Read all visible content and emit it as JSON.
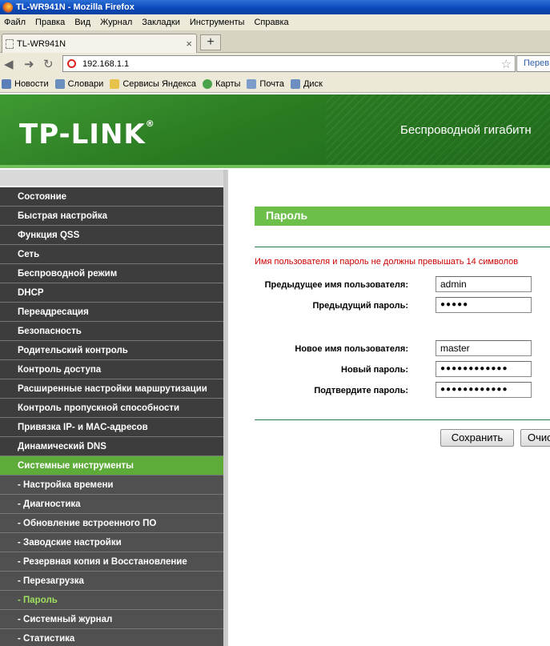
{
  "window": {
    "title": "TL-WR941N - Mozilla Firefox"
  },
  "menubar": [
    "Файл",
    "Правка",
    "Вид",
    "Журнал",
    "Закладки",
    "Инструменты",
    "Справка"
  ],
  "tab": {
    "label": "TL-WR941N",
    "close": "×",
    "new_tab": "+"
  },
  "nav": {
    "url": "192.168.1.1",
    "search_placeholder": "Перев"
  },
  "bookmarks": [
    "Новости",
    "Словари",
    "Сервисы Яндекса",
    "Карты",
    "Почта",
    "Диск"
  ],
  "header": {
    "logo": "TP-LINK",
    "logo_mark": "®",
    "title": "Беспроводной гигабитн"
  },
  "sidebar": {
    "items": [
      "Состояние",
      "Быстрая настройка",
      "Функция QSS",
      "Сеть",
      "Беспроводной режим",
      "DHCP",
      "Переадресация",
      "Безопасность",
      "Родительский контроль",
      "Контроль доступа",
      "Расширенные настройки маршрутизации",
      "Контроль пропускной способности",
      "Привязка IP- и MAC-адресов",
      "Динамический DNS",
      "Системные инструменты"
    ],
    "subitems": [
      "- Настройка времени",
      "- Диагностика",
      "- Обновление встроенного ПО",
      "- Заводские настройки",
      "- Резервная копия и Восстановление",
      "- Перезагрузка",
      "- Пароль",
      "- Системный журнал",
      "- Статистика"
    ]
  },
  "form": {
    "section_title": "Пароль",
    "warning": "Имя пользователя и пароль не должны превышать 14 символов",
    "old_user_label": "Предыдущее имя пользователя:",
    "old_user_value": "admin",
    "old_pass_label": "Предыдущий пароль:",
    "old_pass_value": "●●●●●",
    "new_user_label": "Новое имя пользователя:",
    "new_user_value": "master",
    "new_pass_label": "Новый пароль:",
    "new_pass_value": "●●●●●●●●●●●●",
    "confirm_label": "Подтвердите пароль:",
    "confirm_value": "●●●●●●●●●●●●",
    "save_label": "Сохранить",
    "clear_label": "Очистить"
  }
}
